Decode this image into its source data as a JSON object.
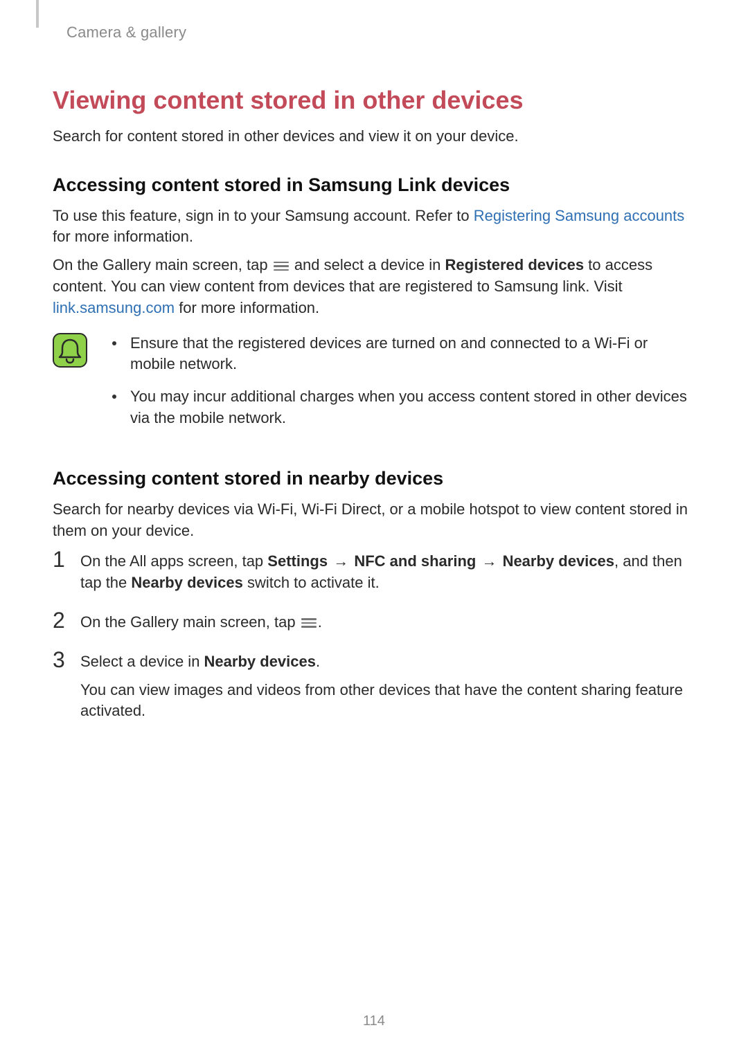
{
  "breadcrumb": "Camera & gallery",
  "section_title": "Viewing content stored in other devices",
  "intro": "Search for content stored in other devices and view it on your device.",
  "sub1": {
    "heading": "Accessing content stored in Samsung Link devices",
    "p1_a": "To use this feature, sign in to your Samsung account. Refer to ",
    "p1_link": "Registering Samsung accounts",
    "p1_b": " for more information.",
    "p2_a": "On the Gallery main screen, tap ",
    "p2_b": " and select a device in ",
    "p2_bold": "Registered devices",
    "p2_c": " to access content. You can view content from devices that are registered to Samsung link. Visit ",
    "p2_link": "link.samsung.com",
    "p2_d": " for more information.",
    "notes": [
      "Ensure that the registered devices are turned on and connected to a Wi-Fi or mobile network.",
      "You may incur additional charges when you access content stored in other devices via the mobile network."
    ]
  },
  "sub2": {
    "heading": "Accessing content stored in nearby devices",
    "intro": "Search for nearby devices via Wi-Fi, Wi-Fi Direct, or a mobile hotspot to view content stored in them on your device.",
    "steps": {
      "s1_a": "On the All apps screen, tap ",
      "s1_b1": "Settings",
      "s1_arrow": " → ",
      "s1_b2": "NFC and sharing",
      "s1_b3": "Nearby devices",
      "s1_c": ", and then tap the ",
      "s1_b4": "Nearby devices",
      "s1_d": " switch to activate it.",
      "s2_a": "On the Gallery main screen, tap ",
      "s2_b": ".",
      "s3_a": "Select a device in ",
      "s3_bold": "Nearby devices",
      "s3_b": ".",
      "s3_extra": "You can view images and videos from other devices that have the content sharing feature activated."
    },
    "nums": {
      "n1": "1",
      "n2": "2",
      "n3": "3"
    }
  },
  "page_number": "114"
}
